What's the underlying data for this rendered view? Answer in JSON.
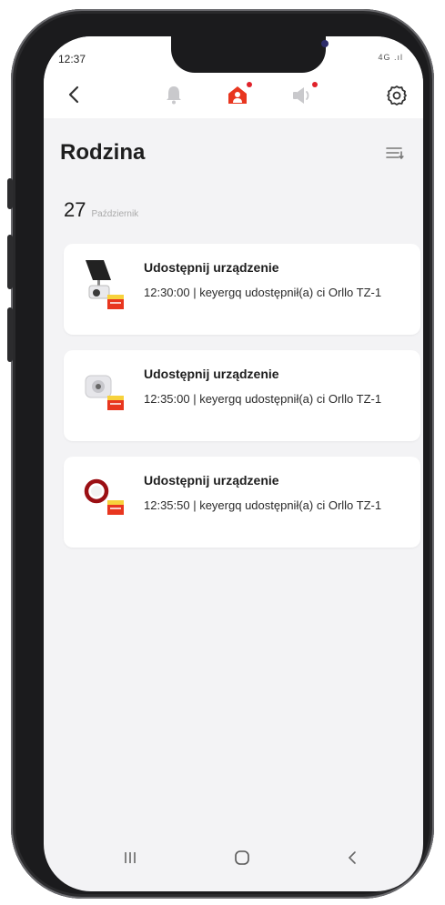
{
  "status_bar": {
    "time": "12:37",
    "indicators": "4G .ıl"
  },
  "header": {
    "back_icon": "chevron-left-icon",
    "tabs": [
      {
        "icon": "bell-icon",
        "active": false,
        "badge": false
      },
      {
        "icon": "family-home-icon",
        "active": true,
        "badge": true
      },
      {
        "icon": "megaphone-icon",
        "active": false,
        "badge": true
      }
    ],
    "settings_icon": "gear-icon",
    "active_color": "#e8361f",
    "badge_color": "#e0222a"
  },
  "page": {
    "title": "Rodzina",
    "filter_icon": "filter-list-icon"
  },
  "date_group": {
    "day": "27",
    "month": "Październik"
  },
  "events": [
    {
      "title": "Udostępnij urządzenie",
      "body": "12:30:00 | keyergq udostępnił(a) ci Orllo TZ-1",
      "device_icon": "solar-camera-icon"
    },
    {
      "title": "Udostępnij urządzenie",
      "body": "12:35:00 | keyergq udostępnił(a) ci Orllo TZ-1",
      "device_icon": "indoor-camera-icon"
    },
    {
      "title": "Udostępnij urządzenie",
      "body": "12:35:50 | keyergq udostępnił(a) ci Orllo TZ-1",
      "device_icon": "smoke-detector-icon"
    }
  ],
  "navbar": {
    "recents_icon": "recents-icon",
    "home_icon": "home-circle-icon",
    "back_icon": "nav-back-icon"
  }
}
